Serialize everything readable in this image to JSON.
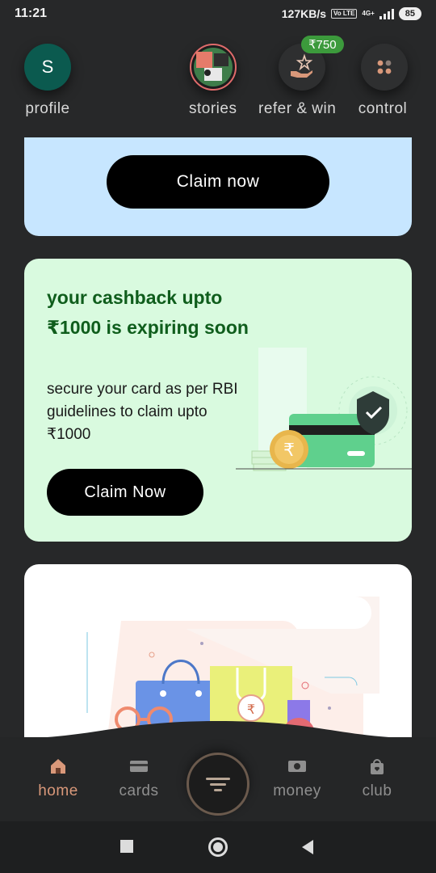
{
  "status_bar": {
    "time": "11:21",
    "speed": "127KB/s",
    "volte": "Vo LTE",
    "network": "4G+",
    "battery": "85"
  },
  "header": {
    "profile": {
      "initial": "S",
      "label": "profile"
    },
    "stories": {
      "label": "stories"
    },
    "refer": {
      "label": "refer & win",
      "badge": "₹750"
    },
    "control": {
      "label": "control"
    }
  },
  "banner_blue": {
    "button_label": "Claim now"
  },
  "banner_green": {
    "title": "your cashback upto ₹1000 is expiring soon",
    "subtitle": "secure your card as per RBI guidelines to claim upto ₹1000",
    "button_label": "Claim Now"
  },
  "bottom_nav": {
    "items": [
      {
        "label": "home",
        "icon": "home-icon",
        "active": true
      },
      {
        "label": "cards",
        "icon": "card-icon",
        "active": false
      },
      {
        "label": "money",
        "icon": "money-icon",
        "active": false
      },
      {
        "label": "club",
        "icon": "club-icon",
        "active": false
      }
    ]
  },
  "colors": {
    "accent": "#d9987a",
    "green_title": "#0f5d1c",
    "badge_green": "#3c9a3c",
    "blue_card": "#c7e6ff",
    "green_card": "#d9fadf"
  }
}
